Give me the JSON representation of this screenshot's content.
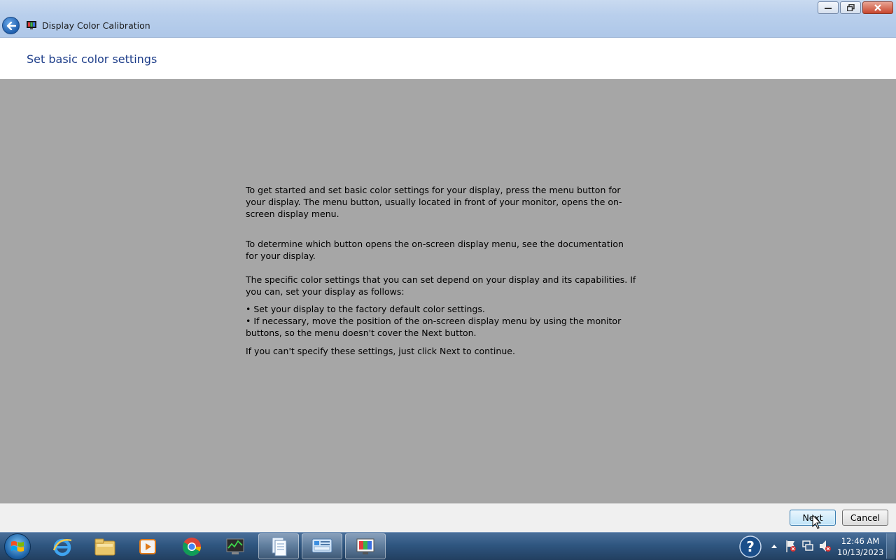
{
  "window": {
    "title": "Display Color Calibration",
    "caption_buttons": [
      "minimize-icon",
      "restore-icon",
      "close-icon"
    ]
  },
  "page": {
    "heading": "Set basic color settings",
    "paragraphs": {
      "p1": "To get started and set basic color settings for your display, press the menu button for your display. The menu button, usually located in front of your monitor, opens the on-screen display menu.",
      "p2": "To determine which button opens the on-screen display menu, see the documentation for your display.",
      "p3": "The specific color settings that you can set depend on your display and its capabilities. If you can, set your display as follows:",
      "bullet1": "• Set your display to the factory default color settings.",
      "bullet2": "• If necessary, move the position of the on-screen display menu by using the monitor buttons, so the menu doesn't cover the Next button.",
      "p4": "If you can't specify these settings,  just click Next to continue."
    }
  },
  "footer": {
    "next_label": "Next",
    "cancel_label": "Cancel"
  },
  "taskbar": {
    "items": [
      "internet-explorer-icon",
      "file-explorer-icon",
      "media-player-icon",
      "chrome-icon",
      "task-manager-icon",
      "document-icon",
      "control-panel-icon",
      "display-calibration-icon"
    ],
    "tray_icons": [
      "help-icon",
      "show-hidden-icons-chevron",
      "action-center-icon",
      "network-icon",
      "volume-muted-icon"
    ],
    "clock": {
      "time": "12:46 AM",
      "date": "10/13/2023"
    }
  },
  "colors": {
    "content_bg": "#a6a6a6",
    "heading": "#1e3e8a",
    "titlebar": "#b9cfec",
    "taskbar": "#2f5680"
  }
}
